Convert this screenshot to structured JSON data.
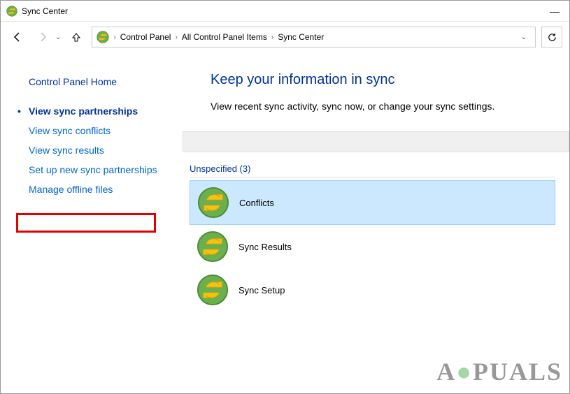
{
  "window": {
    "title": "Sync Center"
  },
  "breadcrumb": {
    "items": [
      {
        "label": "Control Panel"
      },
      {
        "label": "All Control Panel Items"
      },
      {
        "label": "Sync Center"
      }
    ]
  },
  "sidebar": {
    "home": "Control Panel Home",
    "items": [
      {
        "label": "View sync partnerships",
        "active": true
      },
      {
        "label": "View sync conflicts",
        "active": false
      },
      {
        "label": "View sync results",
        "active": false
      },
      {
        "label": "Set up new sync partnerships",
        "active": false
      },
      {
        "label": "Manage offline files",
        "active": false,
        "highlighted": true
      }
    ]
  },
  "content": {
    "title": "Keep your information in sync",
    "subtitle": "View recent sync activity, sync now, or change your sync settings.",
    "group_header": "Unspecified (3)",
    "items": [
      {
        "label": "Conflicts",
        "selected": true
      },
      {
        "label": "Sync Results",
        "selected": false
      },
      {
        "label": "Sync Setup",
        "selected": false
      }
    ]
  },
  "watermark": "APPUALS"
}
